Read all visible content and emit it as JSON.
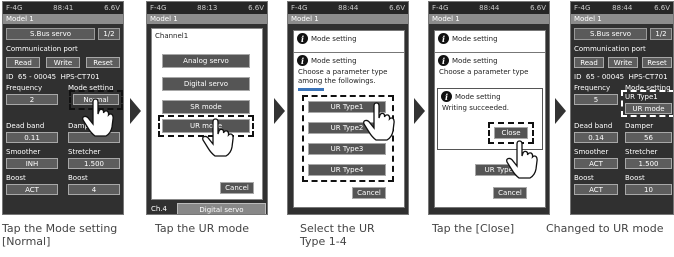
{
  "status": {
    "p1": [
      "F-4G",
      "88:41",
      "6.6V"
    ],
    "p2": [
      "F-4G",
      "88:13",
      "6.6V"
    ],
    "p3": [
      "F-4G",
      "88:44",
      "6.6V"
    ],
    "p4": [
      "F-4G",
      "88:44",
      "6.6V"
    ],
    "p5": [
      "F-4G",
      "88:44",
      "6.6V"
    ]
  },
  "model": "Model 1",
  "sbus": {
    "title": "S.Bus servo",
    "page": "1/2"
  },
  "comm": {
    "label": "Communication port",
    "read": "Read",
    "write": "Write",
    "reset": "Reset"
  },
  "id_row": {
    "id": "ID",
    "num": "65",
    "dash": "-",
    "code": "00045",
    "type": "HPS-CT701"
  },
  "params": {
    "frequency": "Frequency",
    "freq_val1": "2",
    "freq_val5": "5",
    "mode_setting": "Mode setting",
    "mode_normal": "Normal",
    "mode_ur_type1": "UR Type1",
    "mode_ur": "UR mode",
    "dead_band": "Dead band",
    "dead_val1": "0.11",
    "dead_val5": "0.14",
    "damper": "Damper",
    "damper_val5": "56",
    "smoother": "Smoother",
    "smoother_val1": "INH",
    "smoother_val5": "ACT",
    "stretcher": "Stretcher",
    "stretcher_val": "1.500",
    "boost": "Boost",
    "boost_val1": "ACT",
    "boost_val2": "4",
    "boost_val5b": "ACT",
    "boost_val5": "10"
  },
  "channel_menu": {
    "title": "Channel1",
    "items": [
      "Analog servo",
      "Digital servo",
      "SR mode",
      "UR mode"
    ],
    "cancel": "Cancel",
    "ch": "Ch.4",
    "foot": "Digital servo"
  },
  "popup": {
    "title": "Mode setting",
    "question": "Choose a parameter type among the followings.",
    "options": [
      "UR Type1",
      "UR Type2",
      "UR Type3",
      "UR Type4"
    ],
    "cancel": "Cancel",
    "success": "Writing succeeded.",
    "close": "Close",
    "choose_short": "Choose a parameter type"
  },
  "captions": [
    "Tap the Mode setting [Normal]",
    "Tap the UR mode",
    "Select the UR Type 1-4",
    "Tap the [Close]",
    "Changed to UR mode"
  ]
}
